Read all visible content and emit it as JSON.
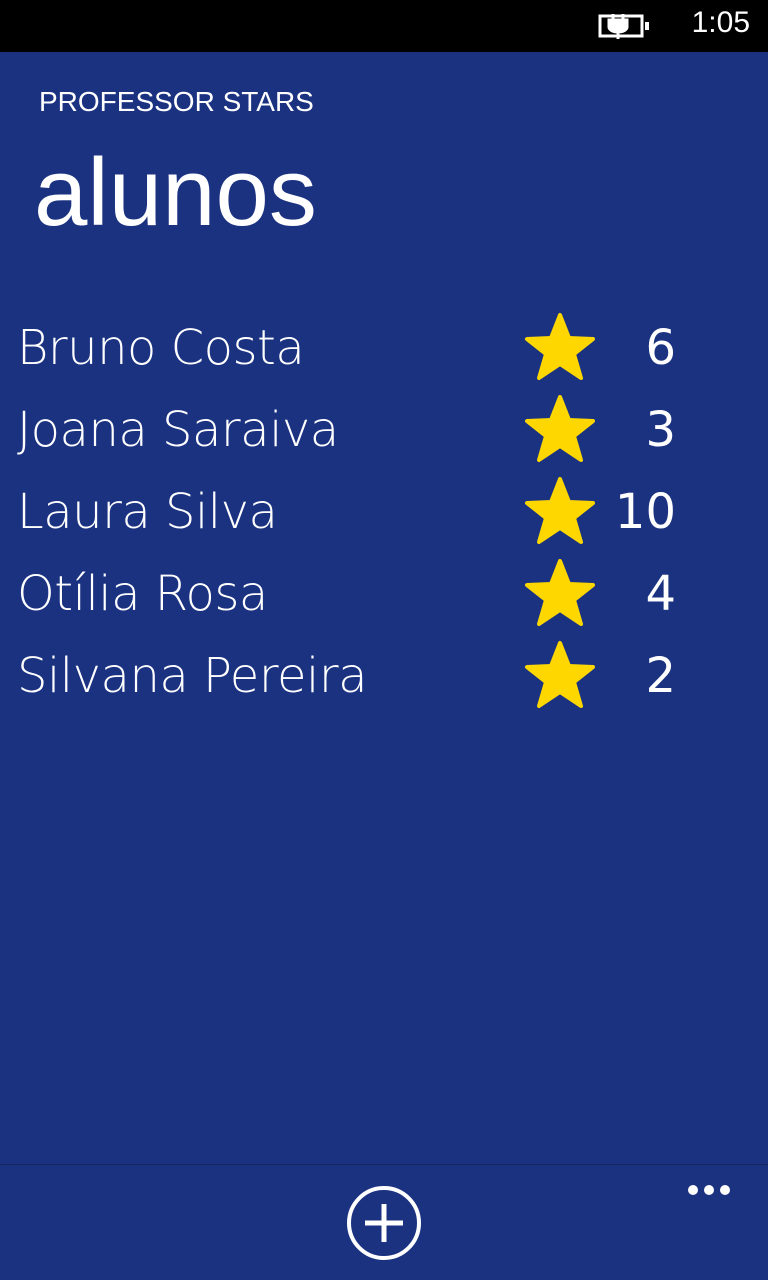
{
  "status_bar": {
    "time": "1:05",
    "battery_icon": "battery-charging-icon"
  },
  "header": {
    "app_title": "PROFESSOR STARS",
    "page_title": "alunos"
  },
  "students": [
    {
      "name": "Bruno Costa",
      "stars": "6"
    },
    {
      "name": "Joana Saraiva",
      "stars": "3"
    },
    {
      "name": "Laura Silva",
      "stars": "10"
    },
    {
      "name": "Otília Rosa",
      "stars": "4"
    },
    {
      "name": "Silvana Pereira",
      "stars": "2"
    }
  ],
  "app_bar": {
    "add_icon": "add-circle-icon",
    "more_icon": "ellipsis-icon"
  },
  "colors": {
    "background": "#1b3281",
    "star": "#ffd700"
  }
}
